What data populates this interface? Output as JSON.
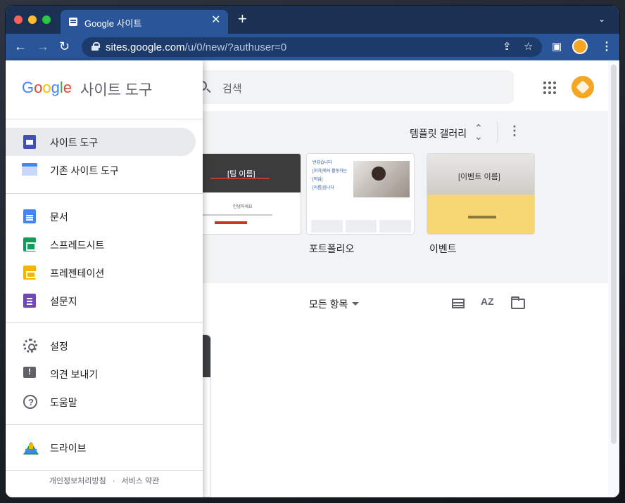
{
  "browser": {
    "tab_title": "Google 사이트",
    "new_tab": "+",
    "url_host": "sites.google.com",
    "url_path": "/u/0/new/?authuser=0",
    "tab_search": "⌄"
  },
  "header": {
    "search_placeholder": "검색"
  },
  "gallery": {
    "label": "템플릿 갤러리",
    "templates": [
      {
        "name": "",
        "thumb_title": "[팀 이름]",
        "thumb_text": "안녕하세요"
      },
      {
        "name": "포트폴리오",
        "thumb_lines": [
          "반갑습니다",
          "[위치]에서 활동하는",
          "[직업]",
          "[이름]입니다"
        ]
      },
      {
        "name": "이벤트",
        "thumb_title": "[이벤트 이름]"
      }
    ]
  },
  "files": {
    "filter_label": "모든 항목",
    "sort_label": "AZ"
  },
  "drawer": {
    "logo_text": "Google",
    "product_name": "사이트 도구",
    "sections": [
      {
        "items": [
          {
            "label": "사이트 도구",
            "icon": "sites-icon",
            "active": true
          },
          {
            "label": "기존 사이트 도구",
            "icon": "classic-sites-icon",
            "active": false
          }
        ]
      },
      {
        "items": [
          {
            "label": "문서",
            "icon": "docs-icon"
          },
          {
            "label": "스프레드시트",
            "icon": "sheets-icon"
          },
          {
            "label": "프레젠테이션",
            "icon": "slides-icon"
          },
          {
            "label": "설문지",
            "icon": "forms-icon"
          }
        ]
      },
      {
        "items": [
          {
            "label": "설정",
            "icon": "settings-icon"
          },
          {
            "label": "의견 보내기",
            "icon": "feedback-icon"
          },
          {
            "label": "도움말",
            "icon": "help-icon"
          }
        ]
      },
      {
        "items": [
          {
            "label": "드라이브",
            "icon": "drive-icon"
          }
        ]
      }
    ],
    "footer_privacy": "개인정보처리방침",
    "footer_sep": "·",
    "footer_terms": "서비스 약관"
  },
  "colors": {
    "tabstrip": "#1a3153",
    "toolbar": "#2a5599",
    "active_item": "#e8eaed"
  }
}
